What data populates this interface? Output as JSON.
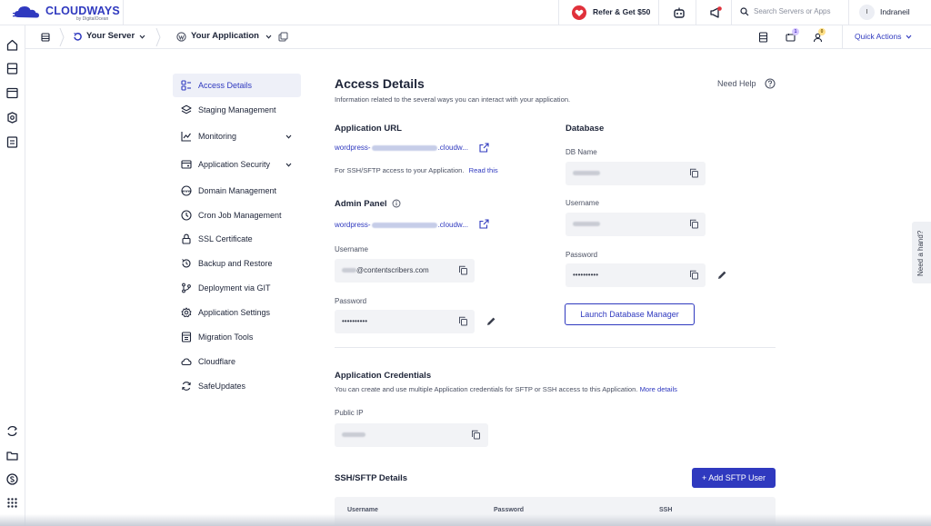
{
  "brand": {
    "name": "CLOUDWAYS",
    "byline": "by DigitalOcean",
    "color": "#2f39bf"
  },
  "topbar": {
    "refer": "Refer & Get $50",
    "search_placeholder": "Search Servers or Apps",
    "user_initial": "I",
    "user_name": "Indraneil"
  },
  "subbar": {
    "server_label": "Your Server",
    "app_label": "Your Application",
    "quick_actions": "Quick Actions",
    "badge_one": "1",
    "badge_two": "0"
  },
  "menu": {
    "items": [
      {
        "label": "Access Details",
        "icon": "access-details-icon"
      },
      {
        "label": "Staging Management",
        "icon": "layers-icon"
      },
      {
        "label": "Monitoring",
        "icon": "chart-icon"
      },
      {
        "label": "Application Security",
        "icon": "shield-icon"
      },
      {
        "label": "Domain Management",
        "icon": "www-icon"
      },
      {
        "label": "Cron Job Management",
        "icon": "clock-icon"
      },
      {
        "label": "SSL Certificate",
        "icon": "lock-icon"
      },
      {
        "label": "Backup and Restore",
        "icon": "restore-icon"
      },
      {
        "label": "Deployment via GIT",
        "icon": "git-icon"
      },
      {
        "label": "Application Settings",
        "icon": "gear-icon"
      },
      {
        "label": "Migration Tools",
        "icon": "migration-icon"
      },
      {
        "label": "Cloudflare",
        "icon": "cloud-icon"
      },
      {
        "label": "SafeUpdates",
        "icon": "refresh-icon"
      }
    ]
  },
  "main": {
    "title": "Access Details",
    "subtitle": "Information related to the several ways you can interact with your application.",
    "need_help": "Need Help",
    "app_url": {
      "heading": "Application URL",
      "prefix": "wordpress-",
      "suffix": ".cloudw...",
      "ssh_note": "For SSH/SFTP access to your Application.",
      "read_this": "Read this"
    },
    "admin_panel": {
      "heading": "Admin Panel",
      "prefix": "wordpress-",
      "suffix": ".cloudw...",
      "username_label": "Username",
      "username_suffix": "@contentscribers.com",
      "password_label": "Password",
      "password_value": "••••••••••"
    },
    "database": {
      "heading": "Database",
      "db_name_label": "DB Name",
      "username_label": "Username",
      "password_label": "Password",
      "password_value": "••••••••••",
      "launch_button": "Launch Database Manager"
    },
    "credentials": {
      "heading": "Application Credentials",
      "description": "You can create and use multiple Application credentials for SFTP or SSH access to this Application.",
      "more_details": "More details",
      "public_ip_label": "Public IP"
    },
    "sftp": {
      "heading": "SSH/SFTP Details",
      "add_button": "+ Add SFTP User",
      "columns": [
        "Username",
        "Password",
        "SSH"
      ]
    }
  },
  "need_hand": "Need a hand?"
}
